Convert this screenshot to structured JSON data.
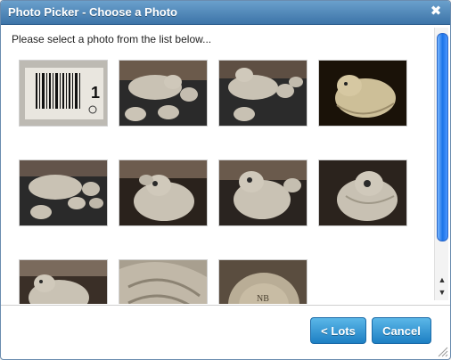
{
  "dialog": {
    "title": "Photo Picker - Choose a Photo",
    "close_icon": "close-icon",
    "prompt": "Please select a photo from the list below..."
  },
  "thumbnails": [
    {
      "subject": "barcode label",
      "label_digit": "1"
    },
    {
      "subject": "ceramic duck figurines"
    },
    {
      "subject": "ceramic duck figurines"
    },
    {
      "subject": "ceramic duck figurine close-up"
    },
    {
      "subject": "ceramic duck figurines"
    },
    {
      "subject": "ceramic bird figurine"
    },
    {
      "subject": "ceramic bird figurines"
    },
    {
      "subject": "ceramic bird figurine"
    },
    {
      "subject": "ceramic duck figurine"
    },
    {
      "subject": "ceramic bird close-up"
    },
    {
      "subject": "figurine base marking",
      "label_text": "NB"
    }
  ],
  "buttons": {
    "back_label": "< Lots",
    "cancel_label": "Cancel"
  },
  "scrollbar": {
    "up_icon": "arrow-up-icon",
    "down_icon": "arrow-down-icon",
    "up_glyph": "▲",
    "down_glyph": "▼"
  },
  "colors": {
    "titlebar": "#3d74a8",
    "button": "#1d7fc3",
    "scroll_thumb": "#1b73e8"
  }
}
